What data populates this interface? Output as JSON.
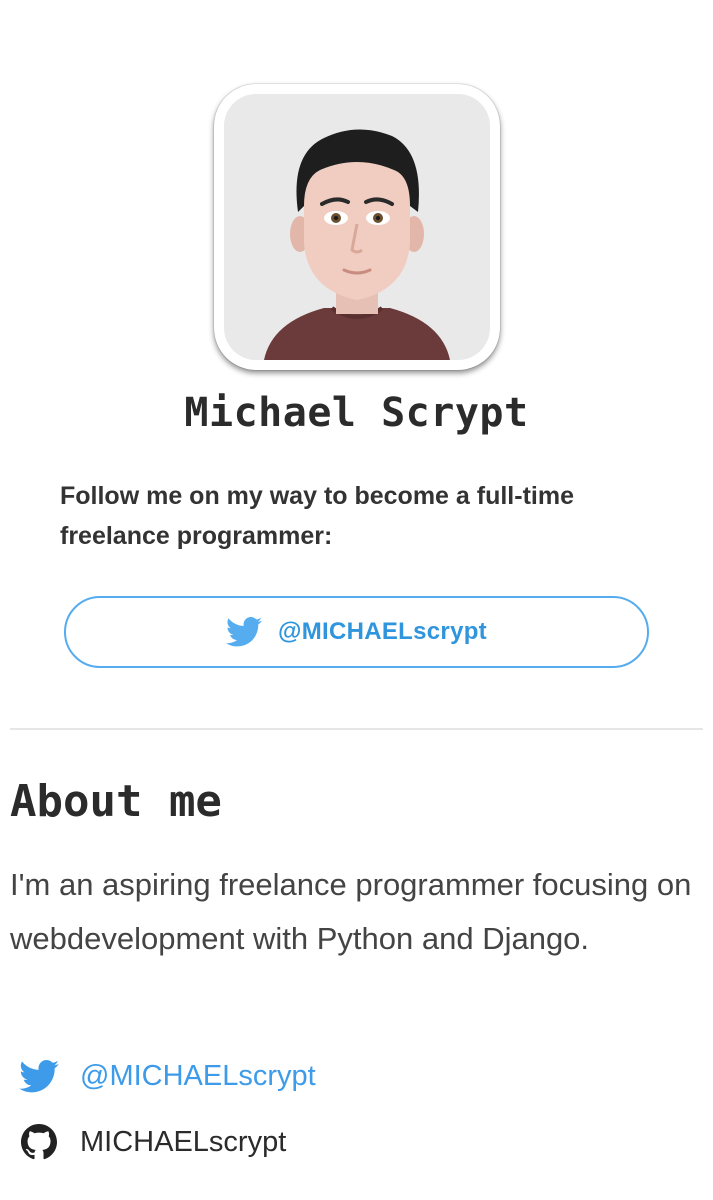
{
  "profile": {
    "name": "Michael Scrypt",
    "intro": "Follow me on my way to become a full-time freelance programmer:",
    "avatar_icon": "memoji-avatar"
  },
  "twitter_button": {
    "icon": "twitter-bird-icon",
    "label": "@MICHAELscrypt"
  },
  "about": {
    "title": "About me",
    "text": "I'm an aspiring freelance programmer focusing on webdevelopment with Python and Django."
  },
  "links": {
    "twitter": {
      "icon": "twitter-bird-icon",
      "label": "@MICHAELscrypt"
    },
    "github": {
      "icon": "github-icon",
      "label": "MICHAELscrypt"
    }
  },
  "colors": {
    "accent": "#55acee",
    "link": "#3d9be9",
    "text": "#2b2b2b",
    "divider": "#e6e6e6"
  }
}
